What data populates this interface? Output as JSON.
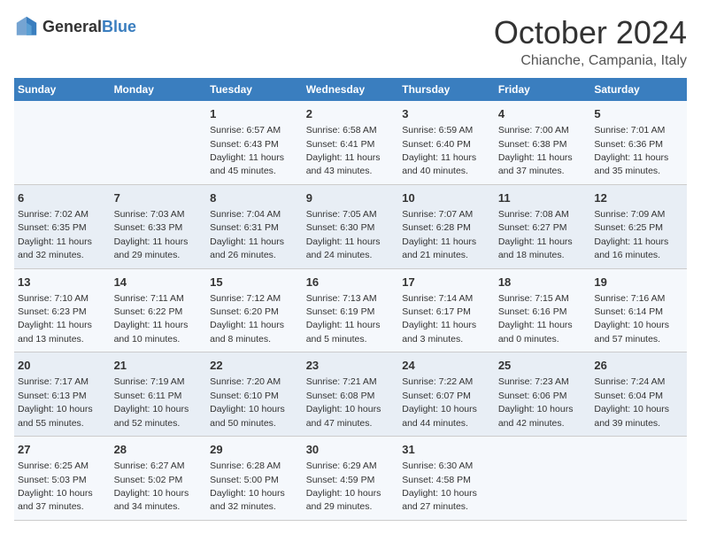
{
  "header": {
    "logo": {
      "general": "General",
      "blue": "Blue"
    },
    "month": "October 2024",
    "location": "Chianche, Campania, Italy"
  },
  "weekdays": [
    "Sunday",
    "Monday",
    "Tuesday",
    "Wednesday",
    "Thursday",
    "Friday",
    "Saturday"
  ],
  "weeks": [
    [
      {
        "day": "",
        "sunrise": "",
        "sunset": "",
        "daylight": ""
      },
      {
        "day": "",
        "sunrise": "",
        "sunset": "",
        "daylight": ""
      },
      {
        "day": "1",
        "sunrise": "Sunrise: 6:57 AM",
        "sunset": "Sunset: 6:43 PM",
        "daylight": "Daylight: 11 hours and 45 minutes."
      },
      {
        "day": "2",
        "sunrise": "Sunrise: 6:58 AM",
        "sunset": "Sunset: 6:41 PM",
        "daylight": "Daylight: 11 hours and 43 minutes."
      },
      {
        "day": "3",
        "sunrise": "Sunrise: 6:59 AM",
        "sunset": "Sunset: 6:40 PM",
        "daylight": "Daylight: 11 hours and 40 minutes."
      },
      {
        "day": "4",
        "sunrise": "Sunrise: 7:00 AM",
        "sunset": "Sunset: 6:38 PM",
        "daylight": "Daylight: 11 hours and 37 minutes."
      },
      {
        "day": "5",
        "sunrise": "Sunrise: 7:01 AM",
        "sunset": "Sunset: 6:36 PM",
        "daylight": "Daylight: 11 hours and 35 minutes."
      }
    ],
    [
      {
        "day": "6",
        "sunrise": "Sunrise: 7:02 AM",
        "sunset": "Sunset: 6:35 PM",
        "daylight": "Daylight: 11 hours and 32 minutes."
      },
      {
        "day": "7",
        "sunrise": "Sunrise: 7:03 AM",
        "sunset": "Sunset: 6:33 PM",
        "daylight": "Daylight: 11 hours and 29 minutes."
      },
      {
        "day": "8",
        "sunrise": "Sunrise: 7:04 AM",
        "sunset": "Sunset: 6:31 PM",
        "daylight": "Daylight: 11 hours and 26 minutes."
      },
      {
        "day": "9",
        "sunrise": "Sunrise: 7:05 AM",
        "sunset": "Sunset: 6:30 PM",
        "daylight": "Daylight: 11 hours and 24 minutes."
      },
      {
        "day": "10",
        "sunrise": "Sunrise: 7:07 AM",
        "sunset": "Sunset: 6:28 PM",
        "daylight": "Daylight: 11 hours and 21 minutes."
      },
      {
        "day": "11",
        "sunrise": "Sunrise: 7:08 AM",
        "sunset": "Sunset: 6:27 PM",
        "daylight": "Daylight: 11 hours and 18 minutes."
      },
      {
        "day": "12",
        "sunrise": "Sunrise: 7:09 AM",
        "sunset": "Sunset: 6:25 PM",
        "daylight": "Daylight: 11 hours and 16 minutes."
      }
    ],
    [
      {
        "day": "13",
        "sunrise": "Sunrise: 7:10 AM",
        "sunset": "Sunset: 6:23 PM",
        "daylight": "Daylight: 11 hours and 13 minutes."
      },
      {
        "day": "14",
        "sunrise": "Sunrise: 7:11 AM",
        "sunset": "Sunset: 6:22 PM",
        "daylight": "Daylight: 11 hours and 10 minutes."
      },
      {
        "day": "15",
        "sunrise": "Sunrise: 7:12 AM",
        "sunset": "Sunset: 6:20 PM",
        "daylight": "Daylight: 11 hours and 8 minutes."
      },
      {
        "day": "16",
        "sunrise": "Sunrise: 7:13 AM",
        "sunset": "Sunset: 6:19 PM",
        "daylight": "Daylight: 11 hours and 5 minutes."
      },
      {
        "day": "17",
        "sunrise": "Sunrise: 7:14 AM",
        "sunset": "Sunset: 6:17 PM",
        "daylight": "Daylight: 11 hours and 3 minutes."
      },
      {
        "day": "18",
        "sunrise": "Sunrise: 7:15 AM",
        "sunset": "Sunset: 6:16 PM",
        "daylight": "Daylight: 11 hours and 0 minutes."
      },
      {
        "day": "19",
        "sunrise": "Sunrise: 7:16 AM",
        "sunset": "Sunset: 6:14 PM",
        "daylight": "Daylight: 10 hours and 57 minutes."
      }
    ],
    [
      {
        "day": "20",
        "sunrise": "Sunrise: 7:17 AM",
        "sunset": "Sunset: 6:13 PM",
        "daylight": "Daylight: 10 hours and 55 minutes."
      },
      {
        "day": "21",
        "sunrise": "Sunrise: 7:19 AM",
        "sunset": "Sunset: 6:11 PM",
        "daylight": "Daylight: 10 hours and 52 minutes."
      },
      {
        "day": "22",
        "sunrise": "Sunrise: 7:20 AM",
        "sunset": "Sunset: 6:10 PM",
        "daylight": "Daylight: 10 hours and 50 minutes."
      },
      {
        "day": "23",
        "sunrise": "Sunrise: 7:21 AM",
        "sunset": "Sunset: 6:08 PM",
        "daylight": "Daylight: 10 hours and 47 minutes."
      },
      {
        "day": "24",
        "sunrise": "Sunrise: 7:22 AM",
        "sunset": "Sunset: 6:07 PM",
        "daylight": "Daylight: 10 hours and 44 minutes."
      },
      {
        "day": "25",
        "sunrise": "Sunrise: 7:23 AM",
        "sunset": "Sunset: 6:06 PM",
        "daylight": "Daylight: 10 hours and 42 minutes."
      },
      {
        "day": "26",
        "sunrise": "Sunrise: 7:24 AM",
        "sunset": "Sunset: 6:04 PM",
        "daylight": "Daylight: 10 hours and 39 minutes."
      }
    ],
    [
      {
        "day": "27",
        "sunrise": "Sunrise: 6:25 AM",
        "sunset": "Sunset: 5:03 PM",
        "daylight": "Daylight: 10 hours and 37 minutes."
      },
      {
        "day": "28",
        "sunrise": "Sunrise: 6:27 AM",
        "sunset": "Sunset: 5:02 PM",
        "daylight": "Daylight: 10 hours and 34 minutes."
      },
      {
        "day": "29",
        "sunrise": "Sunrise: 6:28 AM",
        "sunset": "Sunset: 5:00 PM",
        "daylight": "Daylight: 10 hours and 32 minutes."
      },
      {
        "day": "30",
        "sunrise": "Sunrise: 6:29 AM",
        "sunset": "Sunset: 4:59 PM",
        "daylight": "Daylight: 10 hours and 29 minutes."
      },
      {
        "day": "31",
        "sunrise": "Sunrise: 6:30 AM",
        "sunset": "Sunset: 4:58 PM",
        "daylight": "Daylight: 10 hours and 27 minutes."
      },
      {
        "day": "",
        "sunrise": "",
        "sunset": "",
        "daylight": ""
      },
      {
        "day": "",
        "sunrise": "",
        "sunset": "",
        "daylight": ""
      }
    ]
  ]
}
